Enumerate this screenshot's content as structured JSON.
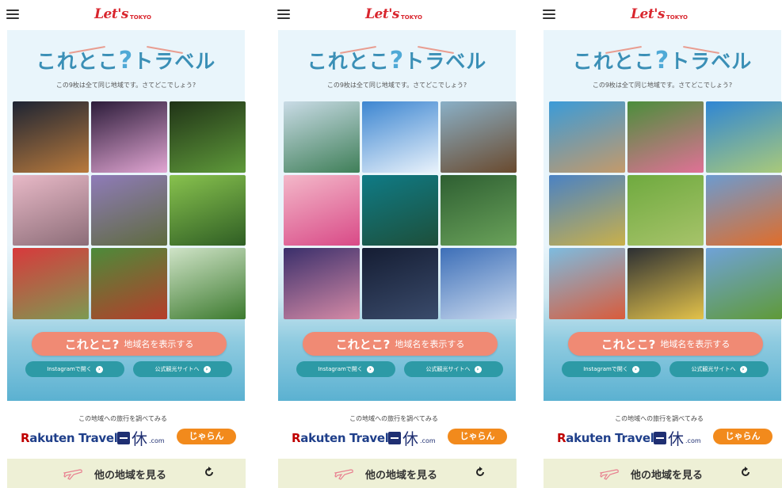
{
  "header": {
    "logo_main": "Let's",
    "logo_sub": "TOKYO"
  },
  "hero": {
    "title_brand": "これとこ",
    "title_q": "?",
    "title_rest": "トラベル",
    "subtitle": "この9枚は全て同じ地域です。さてどこでしょう?"
  },
  "buttons": {
    "show_brand": "これとこ?",
    "show_label": "地域名を表示する",
    "instagram": "Instagramで開く",
    "official": "公式観光サイトへ",
    "arrow": "›"
  },
  "travel": {
    "lead": "この地域への旅行を調べてみる",
    "rakuten_r": "R",
    "rakuten_rest": "akuten Travel",
    "ikkyu_kanji": "休",
    "ikkyu_com": ".com",
    "jalan": "じゃらん"
  },
  "bottom": {
    "label": "他の地域を見る"
  },
  "screens": [
    {
      "tiles": [
        {
          "name": "night-village",
          "c1": "#1d2433",
          "c2": "#b97a3c"
        },
        {
          "name": "lantern-festival",
          "c1": "#2c1c3a",
          "c2": "#e2a6d3"
        },
        {
          "name": "green-window",
          "c1": "#203317",
          "c2": "#5f9a3a"
        },
        {
          "name": "cherry-blossom-path",
          "c1": "#e8b9c7",
          "c2": "#8c6d78"
        },
        {
          "name": "wisteria",
          "c1": "#8f7bb9",
          "c2": "#5e6b3e"
        },
        {
          "name": "forest-light",
          "c1": "#88c24e",
          "c2": "#2f5e24"
        },
        {
          "name": "azalea-path",
          "c1": "#d8393c",
          "c2": "#7d9a52"
        },
        {
          "name": "red-bridge-forest",
          "c1": "#4c8b3a",
          "c2": "#b63d2b"
        },
        {
          "name": "green-gorge",
          "c1": "#cfe3c7",
          "c2": "#3c7a2e"
        }
      ]
    },
    {
      "tiles": [
        {
          "name": "snowy-mountains",
          "c1": "#c9dbe6",
          "c2": "#3f7f58"
        },
        {
          "name": "sky-swing",
          "c1": "#3d86d1",
          "c2": "#e9f2fb"
        },
        {
          "name": "wooden-bridge",
          "c1": "#8ab0c7",
          "c2": "#6a4a2e"
        },
        {
          "name": "cherry-pink-flowers",
          "c1": "#f3b8c9",
          "c2": "#d94a87"
        },
        {
          "name": "turquoise-spring",
          "c1": "#0f7b86",
          "c2": "#1d4f3a"
        },
        {
          "name": "green-pond",
          "c1": "#2e5f32",
          "c2": "#6aa25a"
        },
        {
          "name": "twilight-lake",
          "c1": "#3a2f6b",
          "c2": "#d58aa6"
        },
        {
          "name": "milky-way",
          "c1": "#151d33",
          "c2": "#3a4b6b"
        },
        {
          "name": "castle-sky",
          "c1": "#3d6fb8",
          "c2": "#c9d9ee"
        }
      ]
    },
    {
      "tiles": [
        {
          "name": "seaside-deck",
          "c1": "#3b9bd8",
          "c2": "#c49a6a"
        },
        {
          "name": "rose-arch",
          "c1": "#4b8e3b",
          "c2": "#e07196"
        },
        {
          "name": "coastal-park",
          "c1": "#2f86d4",
          "c2": "#a9c97a"
        },
        {
          "name": "character-statue",
          "c1": "#4a82c4",
          "c2": "#c9b04a"
        },
        {
          "name": "horses-field",
          "c1": "#6faa3f",
          "c2": "#a7c36a"
        },
        {
          "name": "mountain-poppies",
          "c1": "#6c9bd0",
          "c2": "#e06d2a"
        },
        {
          "name": "carp-streamers",
          "c1": "#7dbce0",
          "c2": "#d95b3b"
        },
        {
          "name": "manhole-cover",
          "c1": "#2c2f33",
          "c2": "#e3c24a"
        },
        {
          "name": "sheep-pasture",
          "c1": "#6fa2d8",
          "c2": "#5f9a38"
        }
      ]
    }
  ]
}
